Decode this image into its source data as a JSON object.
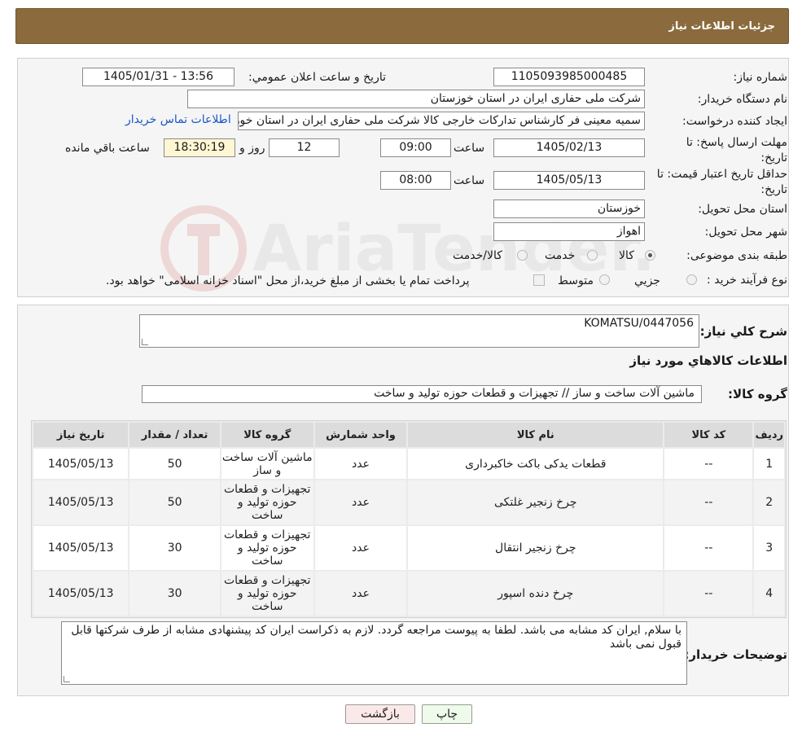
{
  "header": {
    "title": "جزئيات اطلاعات نياز"
  },
  "watermark": {
    "text": "AriaTender.neT"
  },
  "form": {
    "need_number_label": "شماره نياز:",
    "need_number": "1105093985000485",
    "announce_label": "تاريخ و ساعت اعلان عمومي:",
    "announce_value": "1405/01/31 - 13:56",
    "buyer_org_label": "نام دستگاه خريدار:",
    "buyer_org": "شرکت ملی حفاری ایران در استان خوزستان",
    "creator_label": "ايجاد کننده درخواست:",
    "creator": "سمیه معینی فر کارشناس تدارکات خارجی کالا شرکت ملی حفاری ایران در استان خوزستان",
    "contact_link": "اطلاعات تماس خريدار",
    "deadline_label": "مهلت ارسال پاسخ: تا تاريخ:",
    "deadline_date": "1405/02/13",
    "time_label": "ساعت",
    "deadline_time": "09:00",
    "days_value": "12",
    "days_label": "روز و",
    "remaining_time": "18:30:19",
    "remaining_label": "ساعت باقي مانده",
    "validity_label": "حداقل تاريخ اعتبار قيمت: تا تاريخ:",
    "validity_date": "1405/05/13",
    "validity_time": "08:00",
    "province_label": "استان محل تحويل:",
    "province": "خوزستان",
    "city_label": "شهر محل تحويل:",
    "city": "اهواز",
    "category_label": "طبقه بندی موضوعی:",
    "category_options": [
      "کالا",
      "خدمت",
      "کالا/خدمت"
    ],
    "category_selected": "کالا",
    "process_label": "نوع فرآيند خريد :",
    "process_options": [
      "جزيي",
      "متوسط"
    ],
    "process_note": "پرداخت تمام يا بخشی از مبلغ خريد،از محل \"اسناد خزانه اسلامی\" خواهد بود."
  },
  "details": {
    "summary_label": "شرح کلي نياز:",
    "summary_value": "KOMATSU/0447056",
    "items_heading": "اطلاعات کالاهاي مورد نياز",
    "group_label": "گروه کالا:",
    "group_value": "ماشين آلات ساخت و ساز // تجهيزات و قطعات حوزه توليد و ساخت",
    "table": {
      "headers": [
        "رديف",
        "کد کالا",
        "نام کالا",
        "واحد شمارش",
        "گروه کالا",
        "تعداد / مقدار",
        "تاريخ نياز"
      ],
      "rows": [
        [
          "1",
          "--",
          "قطعات یدکی باکت خاکبرداری",
          "عدد",
          "ماشين آلات ساخت و ساز",
          "50",
          "1405/05/13"
        ],
        [
          "2",
          "--",
          "چرخ زنجیر غلتکی",
          "عدد",
          "تجهيزات و قطعات حوزه توليد و ساخت",
          "50",
          "1405/05/13"
        ],
        [
          "3",
          "--",
          "چرخ زنجیر انتقال",
          "عدد",
          "تجهيزات و قطعات حوزه توليد و ساخت",
          "30",
          "1405/05/13"
        ],
        [
          "4",
          "--",
          "چرخ دنده اسپور",
          "عدد",
          "تجهيزات و قطعات حوزه توليد و ساخت",
          "30",
          "1405/05/13"
        ]
      ]
    },
    "buyer_notes_label": "توضيحات خريدار:",
    "buyer_notes": "با سلام, ایران کد مشابه می باشد. لطفا به پیوست مراجعه گردد. لازم به ذکراست ایران کد پیشنهادی مشابه از طرف شرکتها قابل قبول نمی باشد"
  },
  "buttons": {
    "print": "چاپ",
    "back": "بازگشت"
  }
}
